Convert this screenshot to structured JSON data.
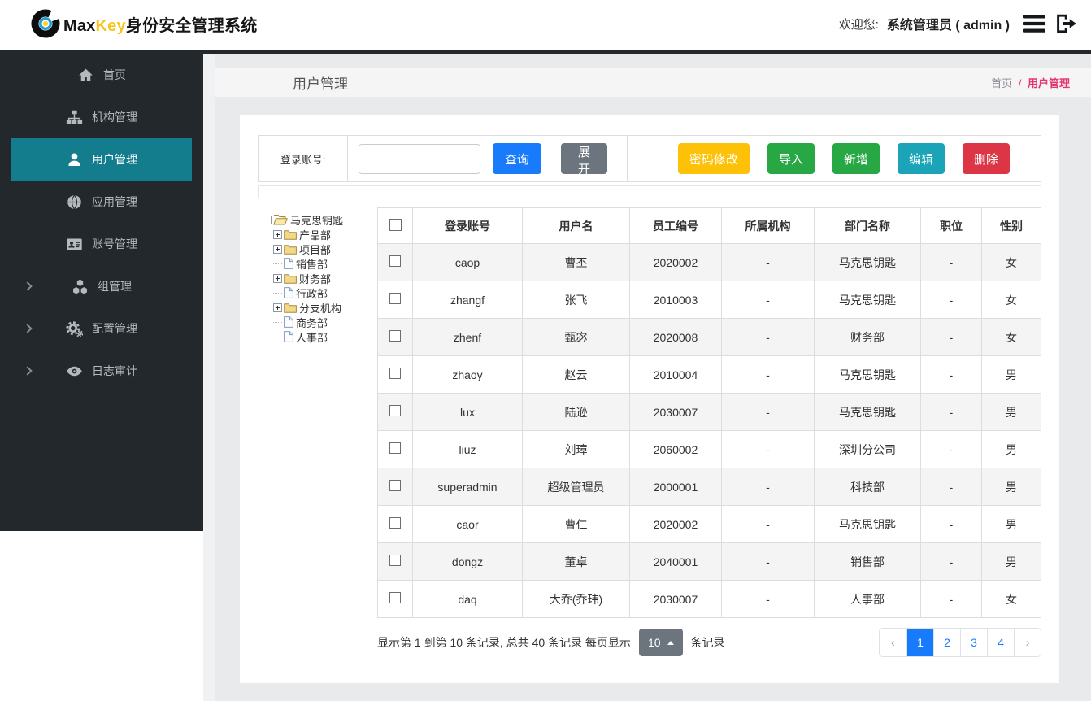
{
  "header": {
    "brand_max": "Max",
    "brand_key": "Key",
    "brand_suffix": "身份安全管理系统",
    "welcome_label": "欢迎您:",
    "user_name": "系统管理员 ( admin )"
  },
  "sidebar": {
    "items": [
      {
        "name": "home",
        "label": "首页",
        "icon": "home",
        "active": false,
        "expandable": false
      },
      {
        "name": "org",
        "label": "机构管理",
        "icon": "sitemap",
        "active": false,
        "expandable": false
      },
      {
        "name": "user",
        "label": "用户管理",
        "icon": "user",
        "active": true,
        "expandable": false
      },
      {
        "name": "app",
        "label": "应用管理",
        "icon": "globe",
        "active": false,
        "expandable": false
      },
      {
        "name": "account",
        "label": "账号管理",
        "icon": "idcard",
        "active": false,
        "expandable": false
      },
      {
        "name": "group",
        "label": "组管理",
        "icon": "cubes",
        "active": false,
        "expandable": true
      },
      {
        "name": "config",
        "label": "配置管理",
        "icon": "cogs",
        "active": false,
        "expandable": true
      },
      {
        "name": "audit",
        "label": "日志审计",
        "icon": "eye",
        "active": false,
        "expandable": true
      }
    ]
  },
  "page": {
    "title": "用户管理",
    "breadcrumb_home": "首页",
    "breadcrumb_sep": "/",
    "breadcrumb_current": "用户管理"
  },
  "search": {
    "label": "登录账号:",
    "input_value": "",
    "query_label": "查询",
    "expand_label": "展开",
    "actions": [
      {
        "name": "password-change-button",
        "label": "密码修改",
        "color": "#fdc107"
      },
      {
        "name": "import-button",
        "label": "导入",
        "color": "#28a745"
      },
      {
        "name": "add-button",
        "label": "新增",
        "color": "#28a745"
      },
      {
        "name": "edit-button",
        "label": "编辑",
        "color": "#1ba4b8"
      },
      {
        "name": "delete-button",
        "label": "删除",
        "color": "#dc3545"
      }
    ]
  },
  "tree": {
    "root": "马克思钥匙",
    "children": [
      {
        "label": "产品部",
        "type": "folder"
      },
      {
        "label": "项目部",
        "type": "folder"
      },
      {
        "label": "销售部",
        "type": "file"
      },
      {
        "label": "财务部",
        "type": "folder"
      },
      {
        "label": "行政部",
        "type": "file"
      },
      {
        "label": "分支机构",
        "type": "folder"
      },
      {
        "label": "商务部",
        "type": "file"
      },
      {
        "label": "人事部",
        "type": "file"
      }
    ]
  },
  "table": {
    "columns": [
      "登录账号",
      "用户名",
      "员工编号",
      "所属机构",
      "部门名称",
      "职位",
      "性别"
    ],
    "rows": [
      [
        "caop",
        "曹丕",
        "2020002",
        "-",
        "马克思钥匙",
        "-",
        "女"
      ],
      [
        "zhangf",
        "张飞",
        "2010003",
        "-",
        "马克思钥匙",
        "-",
        "女"
      ],
      [
        "zhenf",
        "甄宓",
        "2020008",
        "-",
        "财务部",
        "-",
        "女"
      ],
      [
        "zhaoy",
        "赵云",
        "2010004",
        "-",
        "马克思钥匙",
        "-",
        "男"
      ],
      [
        "lux",
        "陆逊",
        "2030007",
        "-",
        "马克思钥匙",
        "-",
        "男"
      ],
      [
        "liuz",
        "刘璋",
        "2060002",
        "-",
        "深圳分公司",
        "-",
        "男"
      ],
      [
        "superadmin",
        "超级管理员",
        "2000001",
        "-",
        "科技部",
        "-",
        "男"
      ],
      [
        "caor",
        "曹仁",
        "2020002",
        "-",
        "马克思钥匙",
        "-",
        "男"
      ],
      [
        "dongz",
        "董卓",
        "2040001",
        "-",
        "销售部",
        "-",
        "男"
      ],
      [
        "daq",
        "大乔(乔玮)",
        "2030007",
        "-",
        "人事部",
        "-",
        "女"
      ]
    ]
  },
  "pagination": {
    "info_prefix": "显示第 1 到第 10 条记录, 总共 40 条记录 每页显示",
    "page_size": "10",
    "info_suffix": "条记录",
    "prev": "‹",
    "next": "›",
    "pages": [
      "1",
      "2",
      "3",
      "4"
    ],
    "active_page": "1"
  },
  "colors": {
    "accent_blue": "#177bfb",
    "sidebar_active": "#147d8d",
    "breadcrumb_active": "#e3356f",
    "button_gray": "#6c757d",
    "button_yellow": "#fdc107",
    "button_green": "#28a745",
    "button_teal": "#1ba4b8",
    "button_red": "#dc3545"
  }
}
